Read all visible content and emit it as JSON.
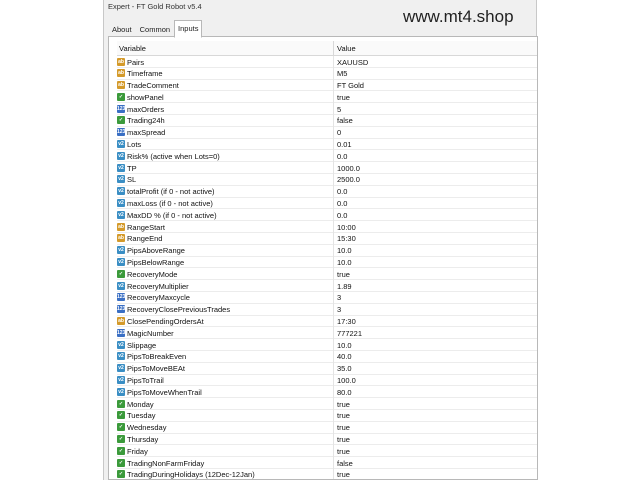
{
  "window": {
    "title": "Expert - FT Gold Robot v5.4"
  },
  "watermark": "www.mt4.shop",
  "tabs": [
    {
      "label": "About"
    },
    {
      "label": "Common"
    },
    {
      "label": "Inputs"
    }
  ],
  "table": {
    "col_variable": "Variable",
    "col_value": "Value",
    "rows": [
      {
        "var": "Pairs",
        "val": "XAUUSD",
        "icon": "ab"
      },
      {
        "var": "Timeframe",
        "val": "M5",
        "icon": "ab"
      },
      {
        "var": "TradeComment",
        "val": "FT Gold",
        "icon": "ab"
      },
      {
        "var": "showPanel",
        "val": "true",
        "icon": "bool"
      },
      {
        "var": "maxOrders",
        "val": "5",
        "icon": "num"
      },
      {
        "var": "Trading24h",
        "val": "false",
        "icon": "bool"
      },
      {
        "var": "maxSpread",
        "val": "0",
        "icon": "num"
      },
      {
        "var": "Lots",
        "val": "0.01",
        "icon": "dbl"
      },
      {
        "var": "Risk% (active when Lots=0)",
        "val": "0.0",
        "icon": "dbl"
      },
      {
        "var": "TP",
        "val": "1000.0",
        "icon": "dbl"
      },
      {
        "var": "SL",
        "val": "2500.0",
        "icon": "dbl"
      },
      {
        "var": "totalProfit (if 0 - not active)",
        "val": "0.0",
        "icon": "dbl"
      },
      {
        "var": "maxLoss (if 0 - not active)",
        "val": "0.0",
        "icon": "dbl"
      },
      {
        "var": "MaxDD % (if 0 - not active)",
        "val": "0.0",
        "icon": "dbl"
      },
      {
        "var": "RangeStart",
        "val": "10:00",
        "icon": "ab"
      },
      {
        "var": "RangeEnd",
        "val": "15:30",
        "icon": "ab"
      },
      {
        "var": "PipsAboveRange",
        "val": "10.0",
        "icon": "dbl"
      },
      {
        "var": "PipsBelowRange",
        "val": "10.0",
        "icon": "dbl"
      },
      {
        "var": "RecoveryMode",
        "val": "true",
        "icon": "bool"
      },
      {
        "var": "RecoveryMultiplier",
        "val": "1.89",
        "icon": "dbl"
      },
      {
        "var": "RecoveryMaxcycle",
        "val": "3",
        "icon": "num"
      },
      {
        "var": "RecoveryClosePreviousTrades",
        "val": "3",
        "icon": "num"
      },
      {
        "var": "ClosePendingOrdersAt",
        "val": "17:30",
        "icon": "ab"
      },
      {
        "var": "MagicNumber",
        "val": "777221",
        "icon": "num"
      },
      {
        "var": "Slippage",
        "val": "10.0",
        "icon": "dbl"
      },
      {
        "var": "PipsToBreakEven",
        "val": "40.0",
        "icon": "dbl"
      },
      {
        "var": "PipsToMoveBEAt",
        "val": "35.0",
        "icon": "dbl"
      },
      {
        "var": "PipsToTrail",
        "val": "100.0",
        "icon": "dbl"
      },
      {
        "var": "PipsToMoveWhenTrail",
        "val": "80.0",
        "icon": "dbl"
      },
      {
        "var": "Monday",
        "val": "true",
        "icon": "bool"
      },
      {
        "var": "Tuesday",
        "val": "true",
        "icon": "bool"
      },
      {
        "var": "Wednesday",
        "val": "true",
        "icon": "bool"
      },
      {
        "var": "Thursday",
        "val": "true",
        "icon": "bool"
      },
      {
        "var": "Friday",
        "val": "true",
        "icon": "bool"
      },
      {
        "var": "TradingNonFarmFriday",
        "val": "false",
        "icon": "bool"
      },
      {
        "var": "TradingDuringHolidays (12Dec-12Jan)",
        "val": "true",
        "icon": "bool"
      }
    ]
  }
}
